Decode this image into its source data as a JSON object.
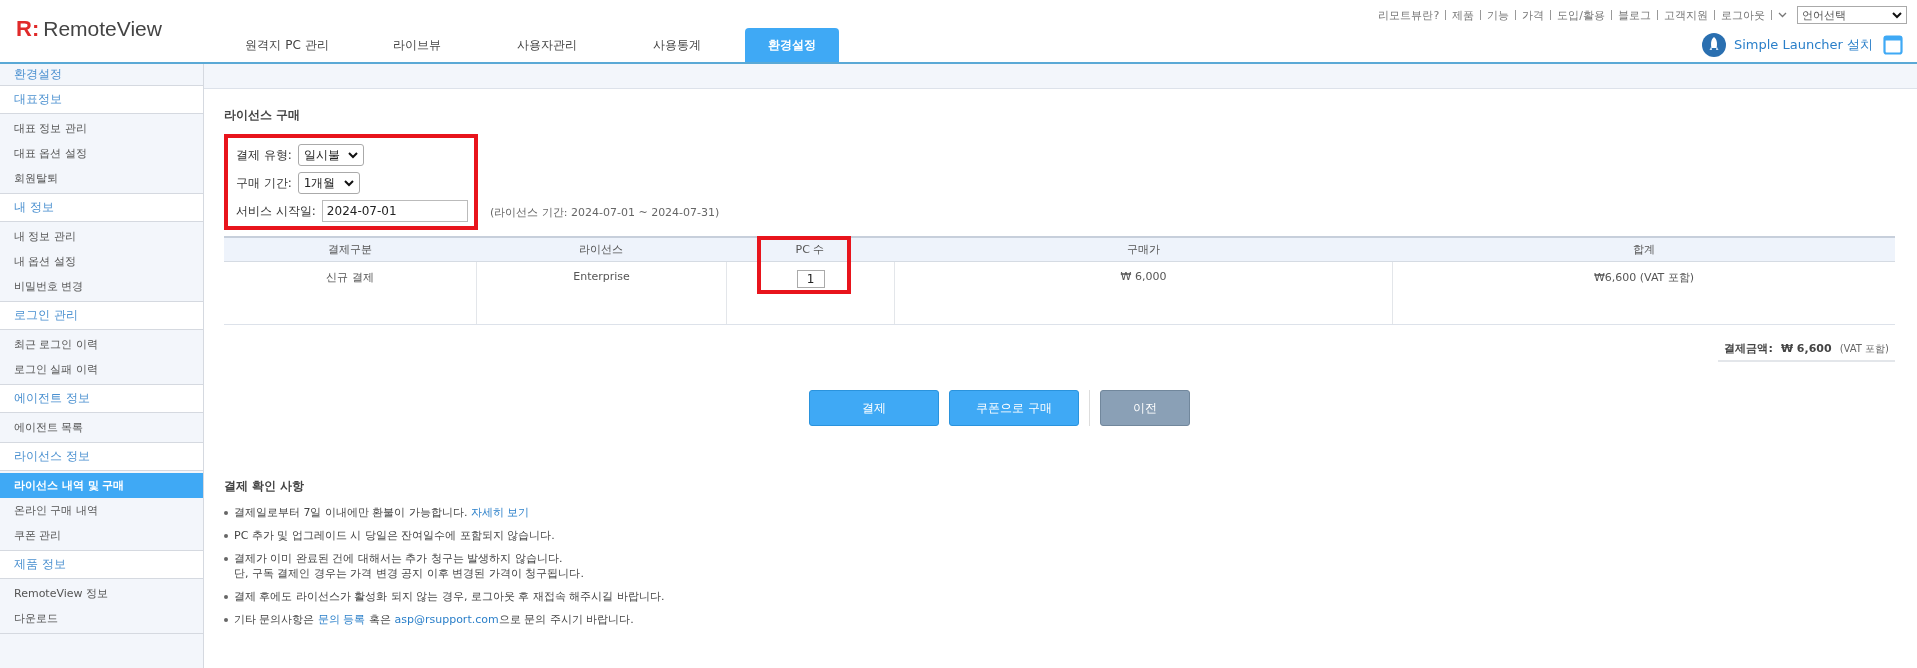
{
  "header": {
    "logo": {
      "mark": "R:",
      "name": "RemoteView"
    },
    "nav_tabs": [
      {
        "label": "원격지 PC 관리",
        "selected": false
      },
      {
        "label": "라이브뷰",
        "selected": false
      },
      {
        "label": "사용자관리",
        "selected": false
      },
      {
        "label": "사용통계",
        "selected": false
      },
      {
        "label": "환경설정",
        "selected": true
      }
    ],
    "utility_links": [
      "리모트뷰란?",
      "제품",
      "기능",
      "가격",
      "도입/활용",
      "블로그",
      "고객지원",
      "로그아웃"
    ],
    "language_select": {
      "value": "언어선택"
    },
    "launcher": {
      "label": "Simple Launcher 설치"
    }
  },
  "sidebar": {
    "title": "환경설정",
    "groups": [
      {
        "title": "대표정보",
        "items": [
          {
            "label": "대표 정보 관리",
            "selected": false
          },
          {
            "label": "대표 옵션 설정",
            "selected": false
          },
          {
            "label": "회원탈퇴",
            "selected": false
          }
        ]
      },
      {
        "title": "내 정보",
        "items": [
          {
            "label": "내 정보 관리",
            "selected": false
          },
          {
            "label": "내 옵션 설정",
            "selected": false
          },
          {
            "label": "비밀번호 변경",
            "selected": false
          }
        ]
      },
      {
        "title": "로그인 관리",
        "items": [
          {
            "label": "최근 로그인 이력",
            "selected": false
          },
          {
            "label": "로그인 실패 이력",
            "selected": false
          }
        ]
      },
      {
        "title": "에이전트 정보",
        "items": [
          {
            "label": "에이전트 목록",
            "selected": false
          }
        ]
      },
      {
        "title": "라이선스 정보",
        "items": [
          {
            "label": "라이선스 내역 및 구매",
            "selected": true
          },
          {
            "label": "온라인 구매 내역",
            "selected": false
          },
          {
            "label": "쿠폰 관리",
            "selected": false
          }
        ]
      },
      {
        "title": "제품 정보",
        "items": [
          {
            "label": "RemoteView 정보",
            "selected": false
          },
          {
            "label": "다운로드",
            "selected": false
          }
        ]
      }
    ]
  },
  "purchase": {
    "title": "라이선스 구매",
    "fields": [
      {
        "kind": "select",
        "label": "결제 유형:",
        "value": "일시불"
      },
      {
        "kind": "select",
        "label": "구매 기간:",
        "value": "1개월"
      },
      {
        "kind": "date",
        "label": "서비스 시작일:",
        "value": "2024-07-01",
        "note": "(라이선스 기간: 2024-07-01 ~ 2024-07-31)"
      }
    ],
    "table": {
      "columns": [
        "결제구분",
        "라이선스",
        "PC 수",
        "구매가",
        "합계"
      ],
      "rows": [
        {
          "type": "신규 결제",
          "license": "Enterprise",
          "pc_count": "1",
          "price": "₩ 6,000",
          "total": "₩6,600 (VAT 포함)"
        }
      ]
    },
    "payment_total": {
      "label": "결제금액:",
      "amount": "₩ 6,600",
      "vat": "(VAT 포함)"
    },
    "buttons": [
      {
        "kind": "primary",
        "label": "결제"
      },
      {
        "kind": "primary",
        "label": "쿠폰으로 구매"
      },
      {
        "kind": "secondary",
        "label": "이전"
      }
    ]
  },
  "notes": {
    "title": "결제 확인 사항",
    "items": [
      {
        "lines": [
          [
            {
              "kind": "text",
              "text": "결제일로부터 7일 이내에만 환불이 가능합니다. "
            },
            {
              "kind": "link",
              "text": "자세히 보기"
            }
          ]
        ]
      },
      {
        "lines": [
          [
            {
              "kind": "text",
              "text": "PC 추가 및 업그레이드 시 당일은 잔여일수에 포함되지 않습니다."
            }
          ]
        ]
      },
      {
        "lines": [
          [
            {
              "kind": "text",
              "text": "결제가 이미 완료된 건에 대해서는 추가 청구는 발생하지 않습니다."
            }
          ],
          [
            {
              "kind": "text",
              "text": "단, 구독 결제인 경우는 가격 변경 공지 이후 변경된 가격이 청구됩니다."
            }
          ]
        ]
      },
      {
        "lines": [
          [
            {
              "kind": "text",
              "text": "결제 후에도 라이선스가 활성화 되지 않는 경우, 로그아웃 후 재접속 해주시길 바랍니다."
            }
          ]
        ]
      },
      {
        "lines": [
          [
            {
              "kind": "text",
              "text": "기타 문의사항은 "
            },
            {
              "kind": "link",
              "text": "문의 등록"
            },
            {
              "kind": "text",
              "text": " 혹은 "
            },
            {
              "kind": "link",
              "text": "asp@rsupport.com"
            },
            {
              "kind": "text",
              "text": "으로 문의 주시기 바랍니다."
            }
          ]
        ]
      }
    ]
  }
}
